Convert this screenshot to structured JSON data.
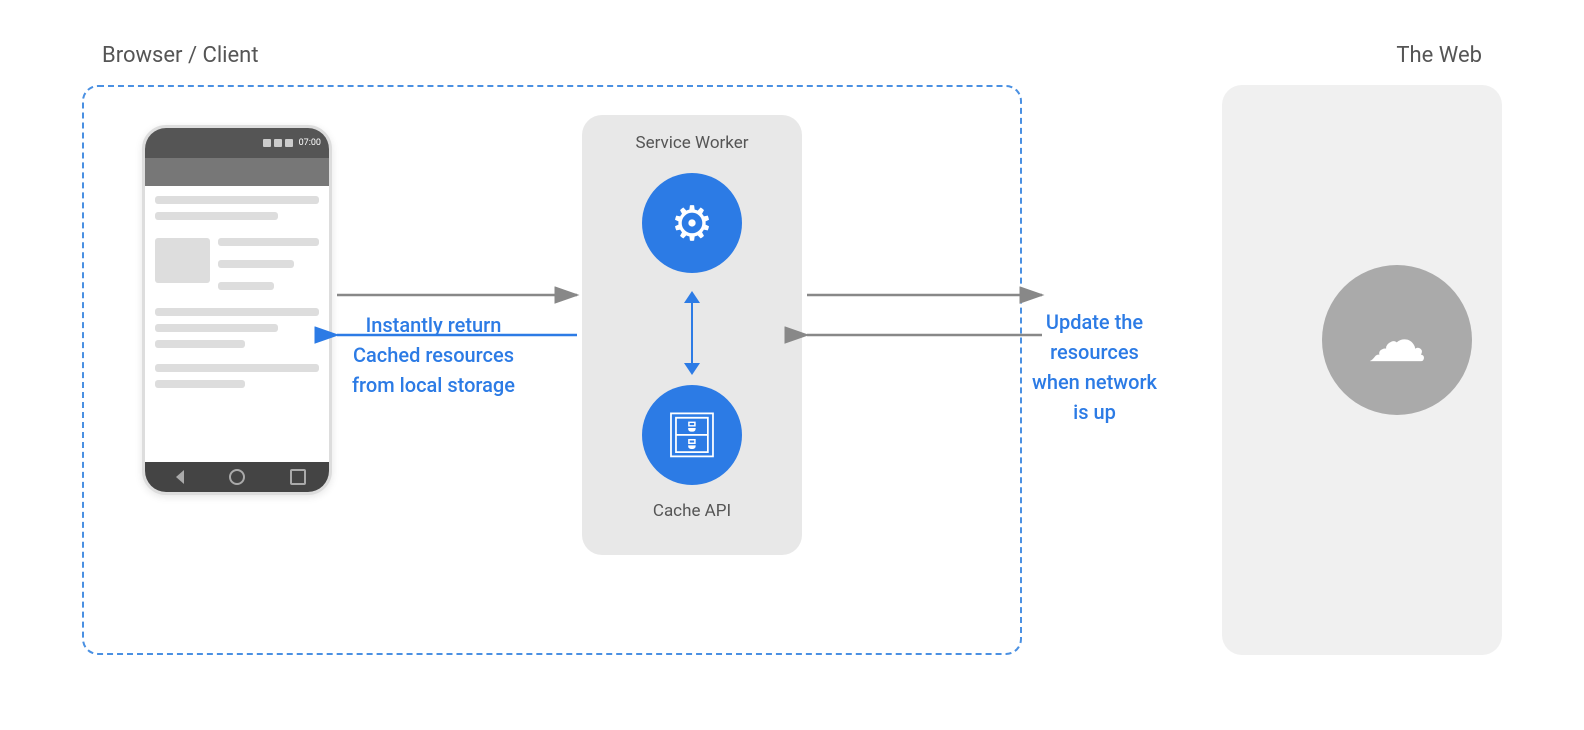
{
  "labels": {
    "browser_client": "Browser / Client",
    "the_web": "The Web",
    "service_worker": "Service Worker",
    "cache_api": "Cache API",
    "instantly_return": "Instantly return",
    "cached_resources": "Cached resources",
    "from_local_storage": "from local storage",
    "update_the": "Update the",
    "resources": "resources",
    "when_network": "when network",
    "is_up": "is up",
    "phone_time": "07:00"
  },
  "colors": {
    "blue_accent": "#2c7be5",
    "dashed_border": "#4a90e2",
    "light_bg": "#e8e8e8",
    "web_bg": "#f0f0f0",
    "cloud_bg": "#aaa",
    "phone_screen": "#fff",
    "phone_bar": "#555"
  },
  "icons": {
    "gear": "⚙",
    "database": "🗄",
    "cloud": "☁"
  }
}
